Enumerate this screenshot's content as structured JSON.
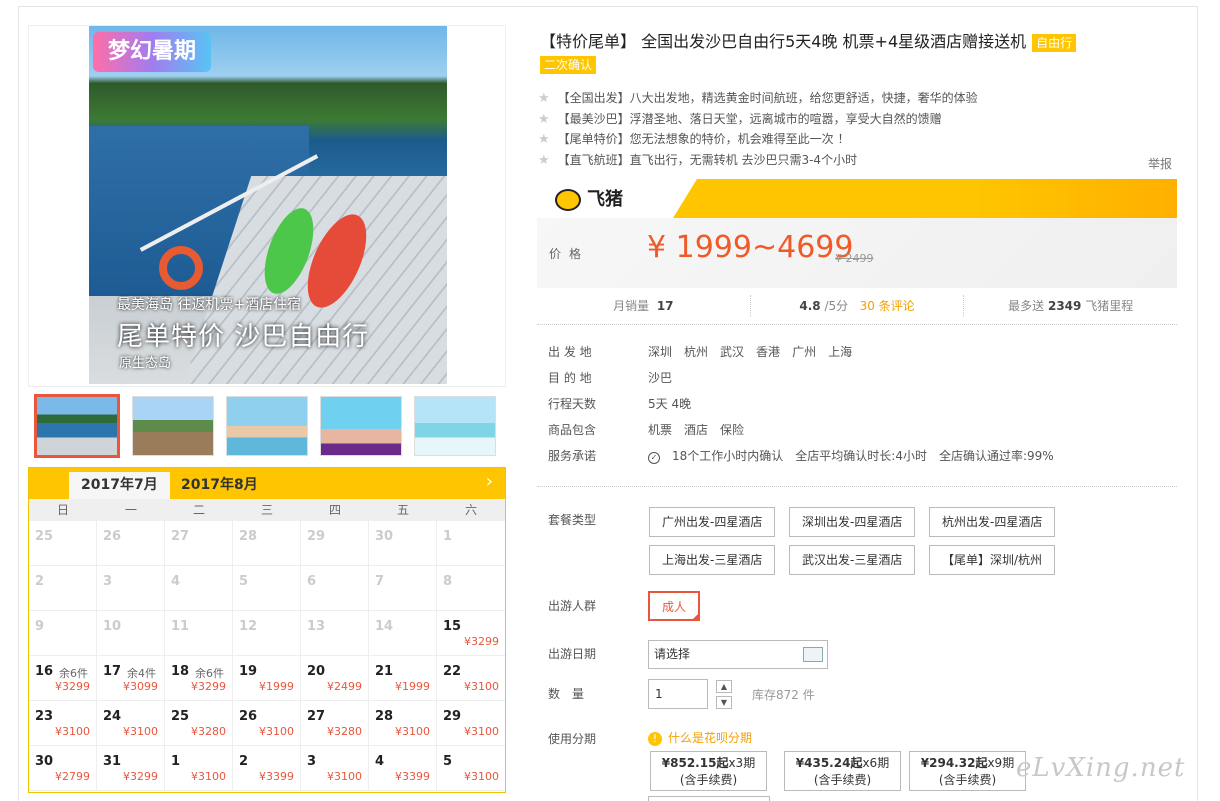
{
  "gallery": {
    "badge": "梦幻暑期",
    "caption_small": "最美海岛 往返机票+酒店住宿",
    "caption_big": "尾单特价 沙巴自由行",
    "caption_foot": "原生态岛"
  },
  "calendar": {
    "tabs": [
      "2017年7月",
      "2017年8月"
    ],
    "next": "›",
    "weekdays": [
      "日",
      "一",
      "二",
      "三",
      "四",
      "五",
      "六"
    ],
    "days": [
      {
        "d": "25",
        "stock": "",
        "price": ""
      },
      {
        "d": "26",
        "stock": "",
        "price": ""
      },
      {
        "d": "27",
        "stock": "",
        "price": ""
      },
      {
        "d": "28",
        "stock": "",
        "price": ""
      },
      {
        "d": "29",
        "stock": "",
        "price": ""
      },
      {
        "d": "30",
        "stock": "",
        "price": ""
      },
      {
        "d": "1",
        "stock": "",
        "price": ""
      },
      {
        "d": "2",
        "stock": "",
        "price": ""
      },
      {
        "d": "3",
        "stock": "",
        "price": ""
      },
      {
        "d": "4",
        "stock": "",
        "price": ""
      },
      {
        "d": "5",
        "stock": "",
        "price": ""
      },
      {
        "d": "6",
        "stock": "",
        "price": ""
      },
      {
        "d": "7",
        "stock": "",
        "price": ""
      },
      {
        "d": "8",
        "stock": "",
        "price": ""
      },
      {
        "d": "9",
        "stock": "",
        "price": ""
      },
      {
        "d": "10",
        "stock": "",
        "price": ""
      },
      {
        "d": "11",
        "stock": "",
        "price": ""
      },
      {
        "d": "12",
        "stock": "",
        "price": ""
      },
      {
        "d": "13",
        "stock": "",
        "price": ""
      },
      {
        "d": "14",
        "stock": "",
        "price": ""
      },
      {
        "d": "15",
        "stock": "",
        "price": "¥3299"
      },
      {
        "d": "16",
        "stock": "余6件",
        "price": "¥3299"
      },
      {
        "d": "17",
        "stock": "余4件",
        "price": "¥3099"
      },
      {
        "d": "18",
        "stock": "余6件",
        "price": "¥3299"
      },
      {
        "d": "19",
        "stock": "",
        "price": "¥1999"
      },
      {
        "d": "20",
        "stock": "",
        "price": "¥2499"
      },
      {
        "d": "21",
        "stock": "",
        "price": "¥1999"
      },
      {
        "d": "22",
        "stock": "",
        "price": "¥3100"
      },
      {
        "d": "23",
        "stock": "",
        "price": "¥3100"
      },
      {
        "d": "24",
        "stock": "",
        "price": "¥3100"
      },
      {
        "d": "25",
        "stock": "",
        "price": "¥3280"
      },
      {
        "d": "26",
        "stock": "",
        "price": "¥3100"
      },
      {
        "d": "27",
        "stock": "",
        "price": "¥3280"
      },
      {
        "d": "28",
        "stock": "",
        "price": "¥3100"
      },
      {
        "d": "29",
        "stock": "",
        "price": "¥3100"
      },
      {
        "d": "30",
        "stock": "",
        "price": "¥2799"
      },
      {
        "d": "31",
        "stock": "",
        "price": "¥3299"
      },
      {
        "d": "1",
        "stock": "",
        "price": "¥3100"
      },
      {
        "d": "2",
        "stock": "",
        "price": "¥3399"
      },
      {
        "d": "3",
        "stock": "",
        "price": "¥3100"
      },
      {
        "d": "4",
        "stock": "",
        "price": "¥3399"
      },
      {
        "d": "5",
        "stock": "",
        "price": "¥3100"
      }
    ]
  },
  "product": {
    "title": "【特价尾单】 全国出发沙巴自由行5天4晚 机票+4星级酒店赠接送机",
    "tag_free": "自由行",
    "tag_confirm": "二次确认",
    "features": [
      "【全国出发】八大出发地，精选黄金时间航班，给您更舒适，快捷，奢华的体验",
      "【最美沙巴】浮潜圣地、落日天堂，远离城市的喧嚣，享受大自然的馈赠",
      "【尾单特价】您无法想象的特价，机会难得至此一次 ！",
      "【直飞航班】直飞出行，无需转机 去沙巴只需3-4个小时"
    ],
    "report": "举报",
    "brand": "飞猪",
    "price_label": "价格",
    "price": "¥ 1999~4699",
    "old_price": "¥ 2499",
    "stats": {
      "sales_label": "月销量",
      "sales": "17",
      "rating": "4.8",
      "rating_suffix": "/5分",
      "reviews": "30 条评论",
      "miles_prefix": "最多送",
      "miles": "2349",
      "miles_suffix": "飞猪里程"
    },
    "info": {
      "from_label": "出 发 地",
      "from": [
        "深圳",
        "杭州",
        "武汉",
        "香港",
        "广州",
        "上海"
      ],
      "to_label": "目 的 地",
      "to": "沙巴",
      "days_label": "行程天数",
      "days": "5天 4晚",
      "includes_label": "商品包含",
      "includes": [
        "机票",
        "酒店",
        "保险"
      ],
      "service_label": "服务承诺",
      "service": [
        "18个工作小时内确认",
        "全店平均确认时长:4小时",
        "全店确认通过率:99%"
      ]
    },
    "options": {
      "pkg_label": "套餐类型",
      "packages": [
        "广州出发-四星酒店",
        "深圳出发-四星酒店",
        "杭州出发-四星酒店",
        "上海出发-三星酒店",
        "武汉出发-三星酒店",
        "【尾单】深圳/杭州"
      ],
      "people_label": "出游人群",
      "people": "成人",
      "date_label": "出游日期",
      "date_placeholder": "请选择",
      "qty_label": "数　量",
      "qty": "1",
      "stock": "库存872 件",
      "installment_label": "使用分期",
      "huabei": "什么是花呗分期",
      "installments": [
        {
          "amount": "¥852.15起",
          "periods": "x3期",
          "note": "(含手续费)"
        },
        {
          "amount": "¥435.24起",
          "periods": "x6期",
          "note": "(含手续费)"
        },
        {
          "amount": "¥294.32起",
          "periods": "x9期",
          "note": "(含手续费)"
        }
      ]
    }
  },
  "watermark": "eLvXing.net"
}
